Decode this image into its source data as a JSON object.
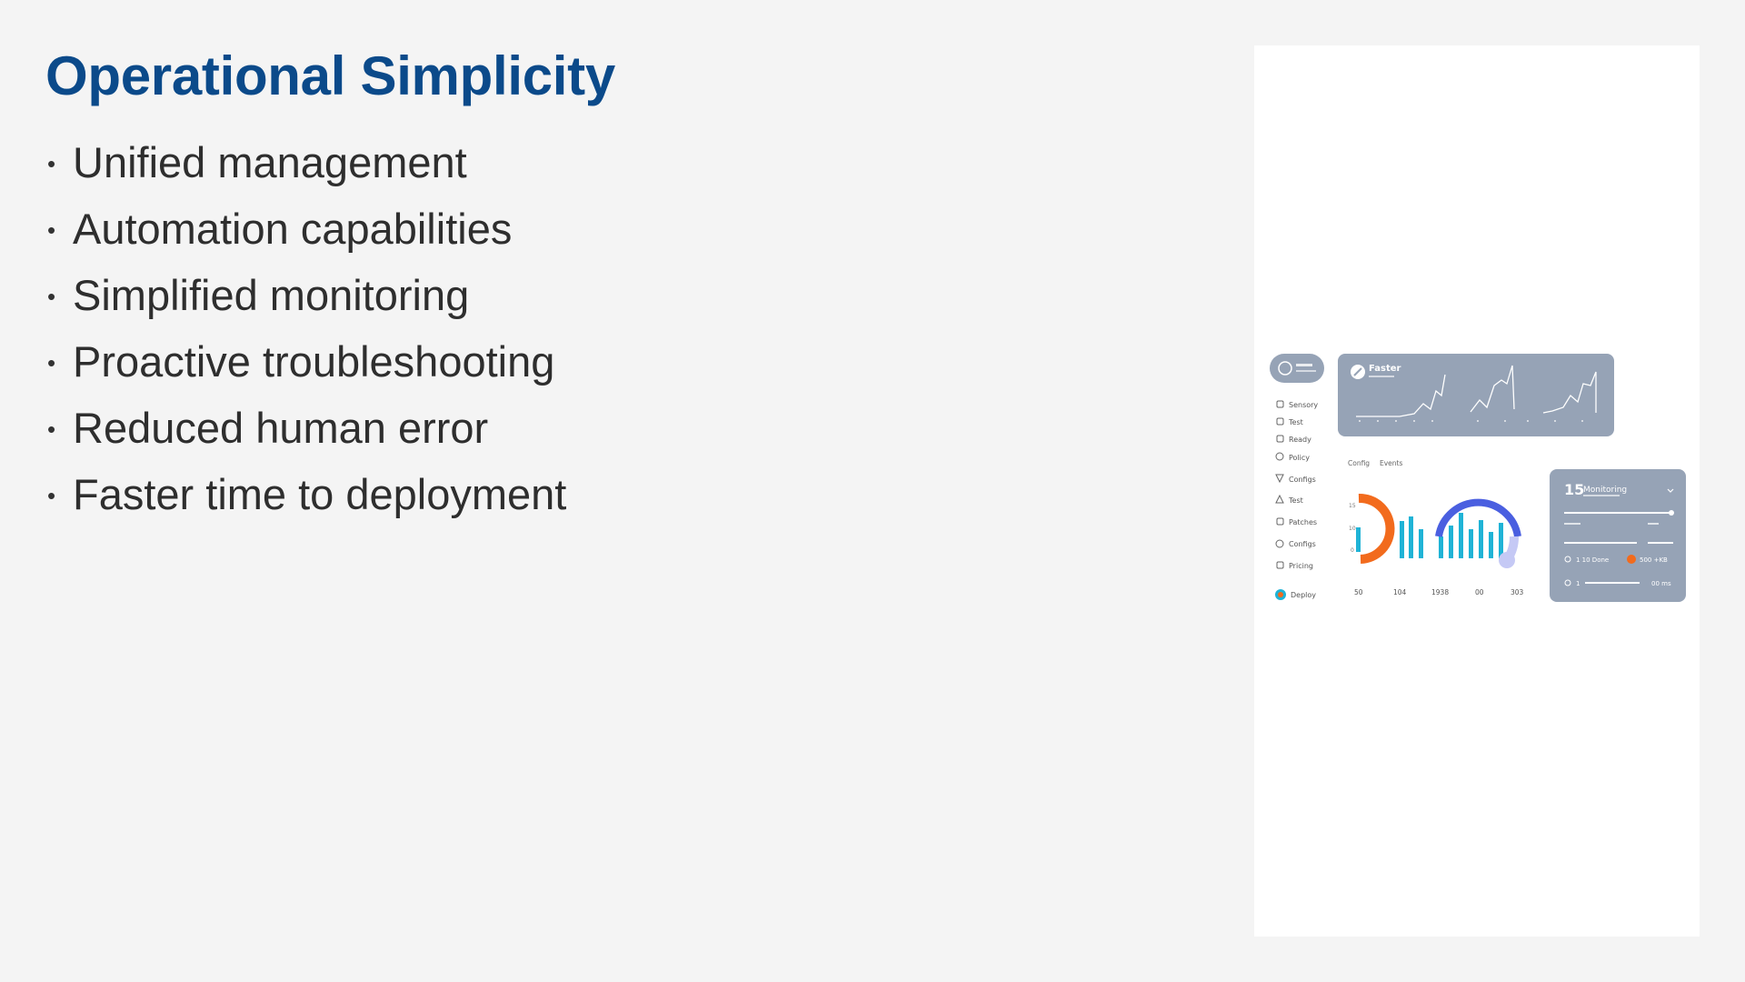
{
  "slide": {
    "title": "Operational Simplicity",
    "bullets": [
      "Unified management",
      "Automation capabilities",
      "Simplified monitoring",
      "Proactive troubleshooting",
      "Reduced human error",
      "Faster time to deployment"
    ],
    "colors": {
      "title": "#0b4a8a",
      "text": "#2e2e2e",
      "panel": "#96a3b6",
      "accent_orange": "#f26b1d",
      "accent_cyan": "#1fb3d6",
      "accent_blue": "#4a5fe0"
    }
  },
  "dashboard_image": {
    "card_top_label": "Faster",
    "stat_number": "15",
    "stat_label": "Monitoring",
    "sidebar_items": [
      "Sensory",
      "Test",
      "Ready",
      "Policy",
      "Configs",
      "Test",
      "Patches",
      "Configs",
      "Pricing",
      "Deploy"
    ],
    "tabs": [
      "Config",
      "Events"
    ],
    "bottom_numbers": [
      "50",
      "104",
      "1938",
      "00",
      "303"
    ],
    "detail_rows": [
      "1 10 Done",
      "500 +KB",
      "1",
      "00 ms"
    ],
    "icons": [
      "gauge-icon",
      "chart-line-icon",
      "donut-chart-icon",
      "bar-chart-icon"
    ]
  }
}
